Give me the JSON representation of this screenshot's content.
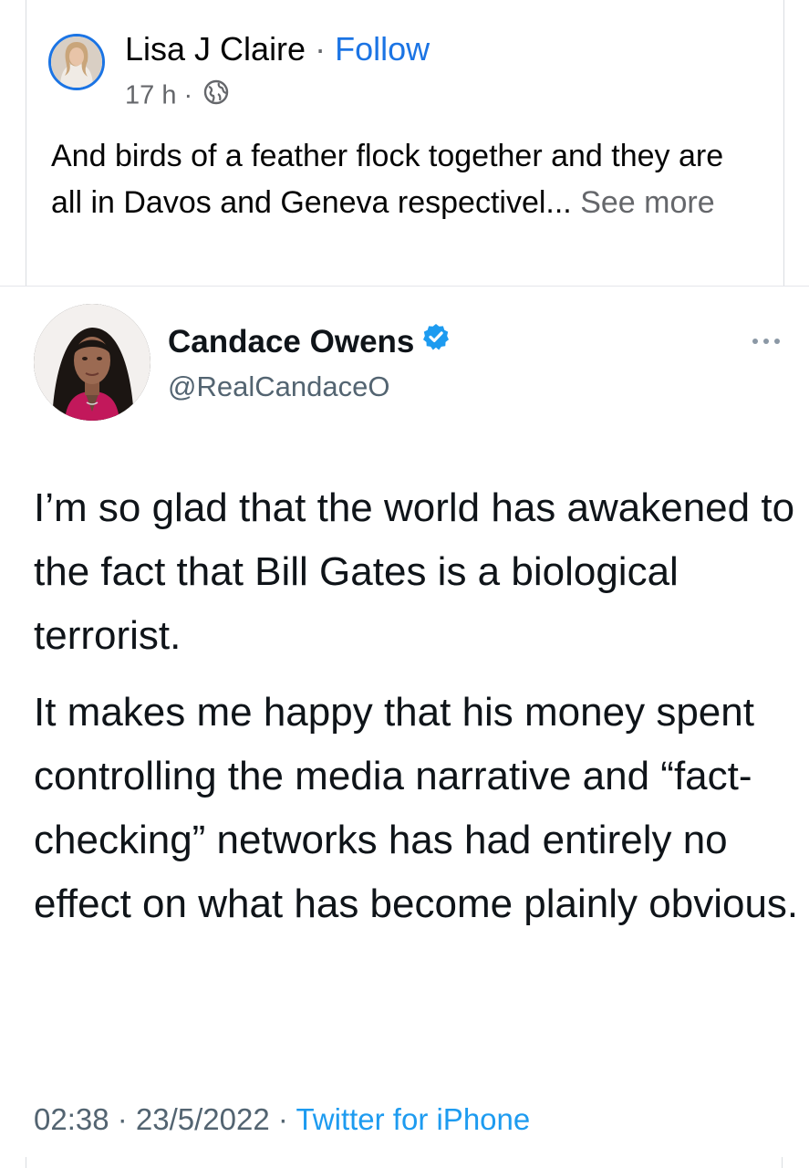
{
  "facebook_post": {
    "author_name": "Lisa J Claire",
    "separator": " · ",
    "follow_label": "Follow",
    "timestamp": "17 h · ",
    "privacy_icon": "globe-icon",
    "text": "And birds of a feather flock together and they are all in Davos and Geneva respectivel... ",
    "see_more_label": "See more"
  },
  "tweet": {
    "display_name": "Candace Owens",
    "verified_icon": "verified-badge-icon",
    "handle": "@RealCandaceO",
    "more_icon": "more-options-icon",
    "paragraphs": [
      "I’m so glad that the world has awakened to the fact that Bill Gates is a biological terrorist.",
      "It makes me happy that his money spent controlling the media narrative and “fact-checking” networks has had entirely no effect on what has become plainly obvious."
    ],
    "time_date": "02:38 · 23/5/2022 · ",
    "source": "Twitter for iPhone"
  },
  "colors": {
    "facebook_blue": "#1b74e4",
    "twitter_blue": "#1d9bf0",
    "muted_gray": "#536471"
  }
}
